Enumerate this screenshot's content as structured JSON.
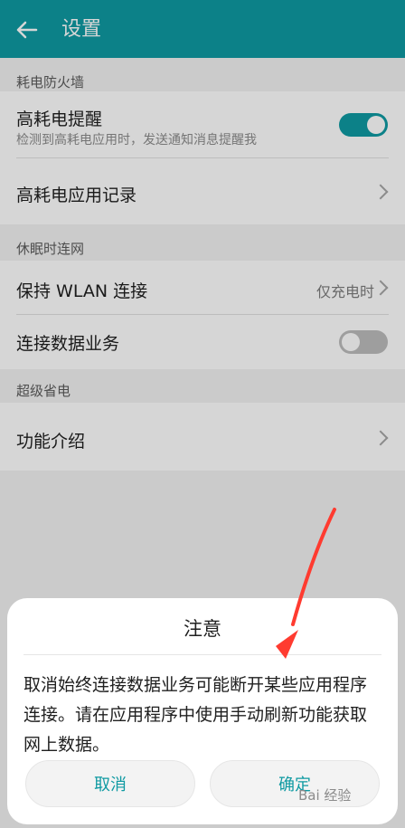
{
  "header": {
    "title": "设置"
  },
  "sections": [
    {
      "label": "耗电防火墙",
      "items": [
        {
          "title": "高耗电提醒",
          "subtitle": "检测到高耗电应用时，发送通知消息提醒我"
        },
        {
          "title": "高耗电应用记录"
        }
      ]
    },
    {
      "label": "休眠时连网",
      "items": [
        {
          "title": "保持 WLAN 连接",
          "value": "仅充电时"
        },
        {
          "title": "连接数据业务"
        }
      ]
    },
    {
      "label": "超级省电",
      "items": [
        {
          "title": "功能介绍"
        }
      ]
    }
  ],
  "dialog": {
    "title": "注意",
    "message": "取消始终连接数据业务可能断开某些应用程序连接。请在应用程序中使用手动刷新功能获取网上数据。",
    "cancel_label": "取消",
    "confirm_label": "确定"
  },
  "watermark": {
    "text": "Bai 经验"
  },
  "colors": {
    "accent": "#0f9aa2",
    "annotation_arrow": "#ff3b30"
  },
  "toggles": {
    "high_power_alert_on": true,
    "data_service_on": false
  }
}
